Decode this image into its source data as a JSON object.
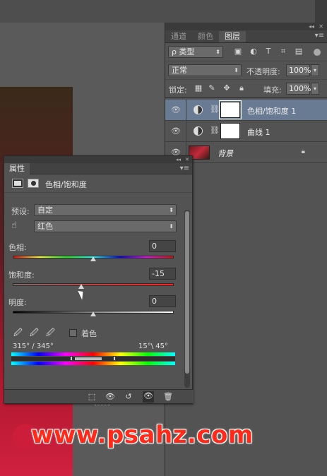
{
  "layers_panel": {
    "tabs": [
      {
        "label": "通道"
      },
      {
        "label": "颜色"
      },
      {
        "label": "图层"
      }
    ],
    "filter_type": "类型",
    "blend_mode": "正常",
    "opacity_label": "不透明度:",
    "opacity_value": "100%",
    "lock_label": "锁定:",
    "fill_label": "填充:",
    "fill_value": "100%",
    "layers": [
      {
        "name": "色相/饱和度 1",
        "selected": true,
        "visible": true
      },
      {
        "name": "曲线 1",
        "selected": false,
        "visible": true
      },
      {
        "name": "背景",
        "selected": false,
        "visible": true,
        "locked": true
      }
    ]
  },
  "properties_panel": {
    "tab_label": "属性",
    "adjustment_title": "色相/饱和度",
    "preset_label": "预设:",
    "preset_value": "自定",
    "channel_value": "红色",
    "hue": {
      "label": "色相:",
      "value": "0",
      "position": 0.5
    },
    "saturation": {
      "label": "饱和度:",
      "value": "-15",
      "position": 0.425
    },
    "lightness": {
      "label": "明度:",
      "value": "0",
      "position": 0.5
    },
    "colorize_label": "着色",
    "colorize_checked": false,
    "range_left": "315° / 345°",
    "range_right": "15°\\ 45°"
  },
  "watermark": "www.psahz.com",
  "colors": {
    "panel_bg": "#535353",
    "selected_layer": "#697a93",
    "watermark": "#ff2a1a"
  }
}
